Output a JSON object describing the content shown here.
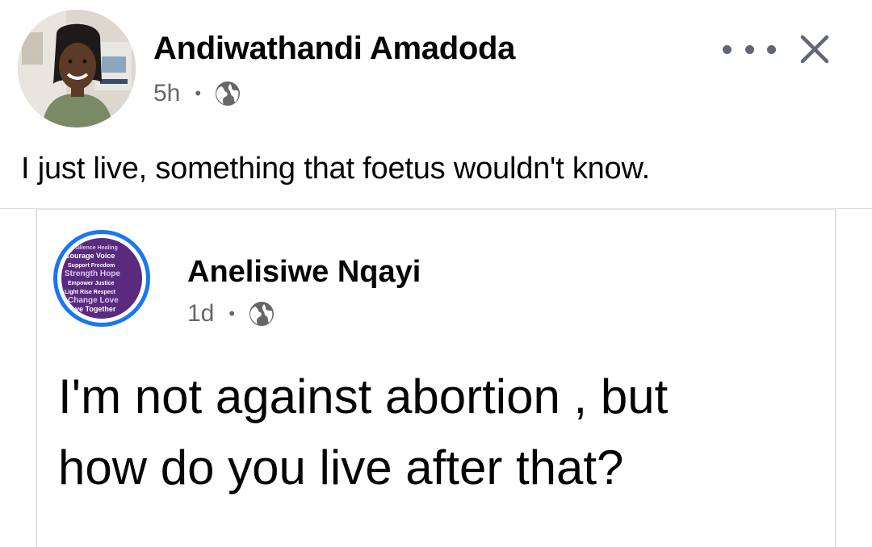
{
  "post": {
    "author": "Andiwathandi Amadoda",
    "time": "5h",
    "separator": "•",
    "privacy_icon": "globe-icon",
    "text": "I just live, something that foetus wouldn't know.",
    "more_icon": "more-options-icon",
    "close_icon": "close-icon"
  },
  "shared_post": {
    "author": "Anelisiwe Nqayi",
    "time": "1d",
    "separator": "•",
    "privacy_icon": "globe-icon",
    "text_line1": "I'm not against abortion , but",
    "text_line2": "how do you live after that?",
    "avatar_words": [
      "Resilience",
      "Healing",
      "Courage",
      "Voice",
      "Support",
      "Freedom",
      "Strength",
      "Hope",
      "Empower",
      "Justice",
      "Light",
      "Rise",
      "Respect",
      "Change",
      "Love",
      "Move",
      "Together"
    ]
  },
  "colors": {
    "text": "#050505",
    "secondary": "#65676b",
    "accent": "#1877f2",
    "avatar_purple": "#5a2a7e"
  }
}
